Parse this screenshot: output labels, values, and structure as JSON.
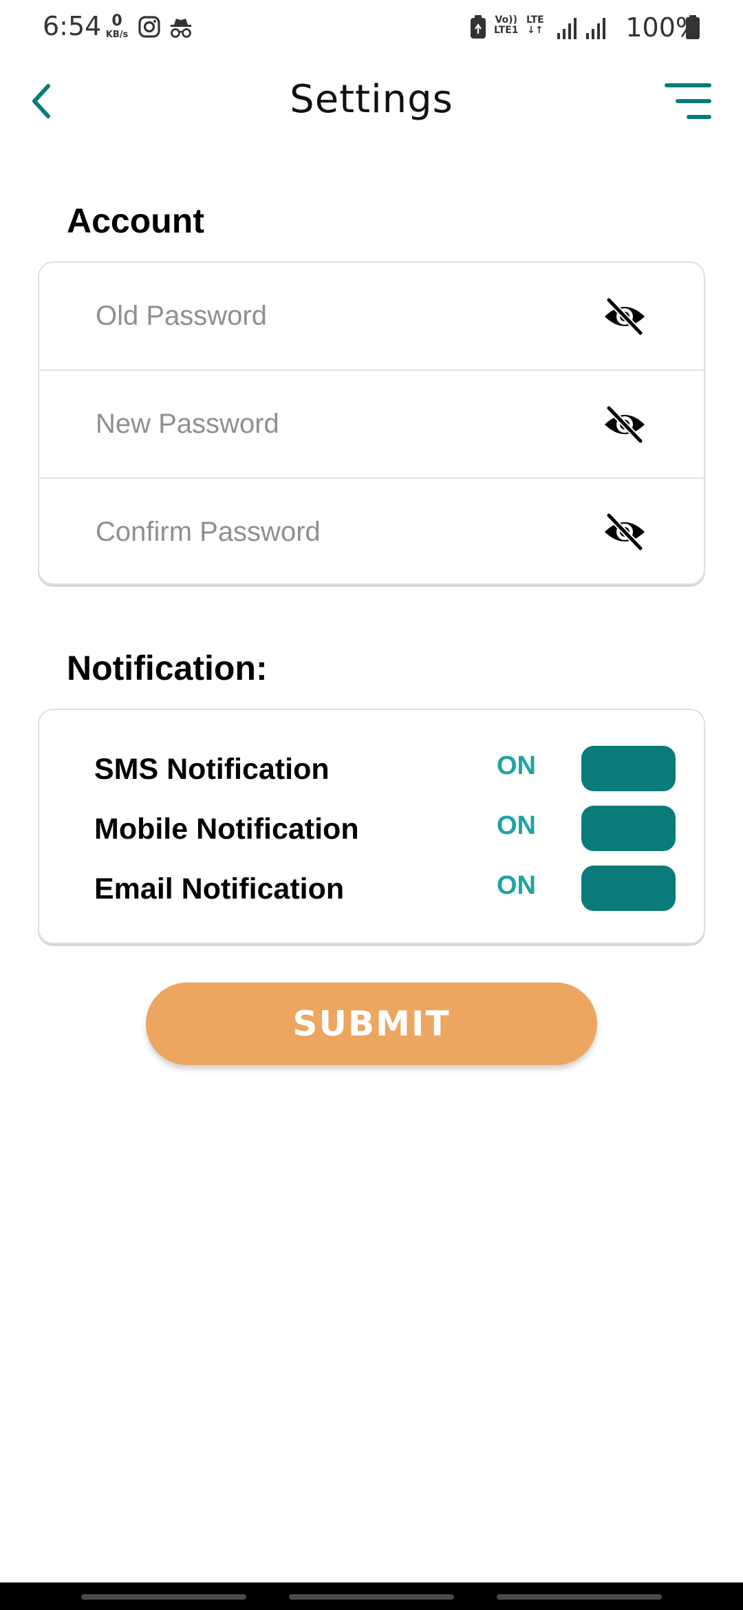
{
  "status_bar": {
    "time": "6:54",
    "net_speed_value": "0",
    "net_speed_unit": "KB/s",
    "vo_label": "Vo))",
    "lte1_label": "LTE1",
    "lte_label": "LTE",
    "data_arrows": "↓↑",
    "battery_percent": "100%",
    "icons": [
      "instagram-icon",
      "incognito-icon",
      "battery-saver-icon",
      "volte-icon",
      "signal-icon",
      "signal-icon",
      "battery-icon"
    ]
  },
  "header": {
    "title": "Settings",
    "back_icon": "chevron-left-icon",
    "menu_icon": "menu-icon"
  },
  "account": {
    "section_title": "Account",
    "fields": [
      {
        "placeholder": "Old Password",
        "value": "",
        "icon": "eye-off-icon"
      },
      {
        "placeholder": "New Password",
        "value": "",
        "icon": "eye-off-icon"
      },
      {
        "placeholder": "Confirm Password",
        "value": "",
        "icon": "eye-off-icon"
      }
    ]
  },
  "notification": {
    "section_title": "Notification:",
    "items": [
      {
        "label": "SMS Notification",
        "state": "ON",
        "enabled": true
      },
      {
        "label": "Mobile Notification",
        "state": "ON",
        "enabled": true
      },
      {
        "label": "Email Notification",
        "state": "ON",
        "enabled": true
      }
    ]
  },
  "submit": {
    "label": "SUBMIT"
  },
  "colors": {
    "accent_teal": "#0a7b7b",
    "on_text_teal": "#1fa3a3",
    "submit_orange": "#eca660",
    "card_border": "#dedede"
  }
}
